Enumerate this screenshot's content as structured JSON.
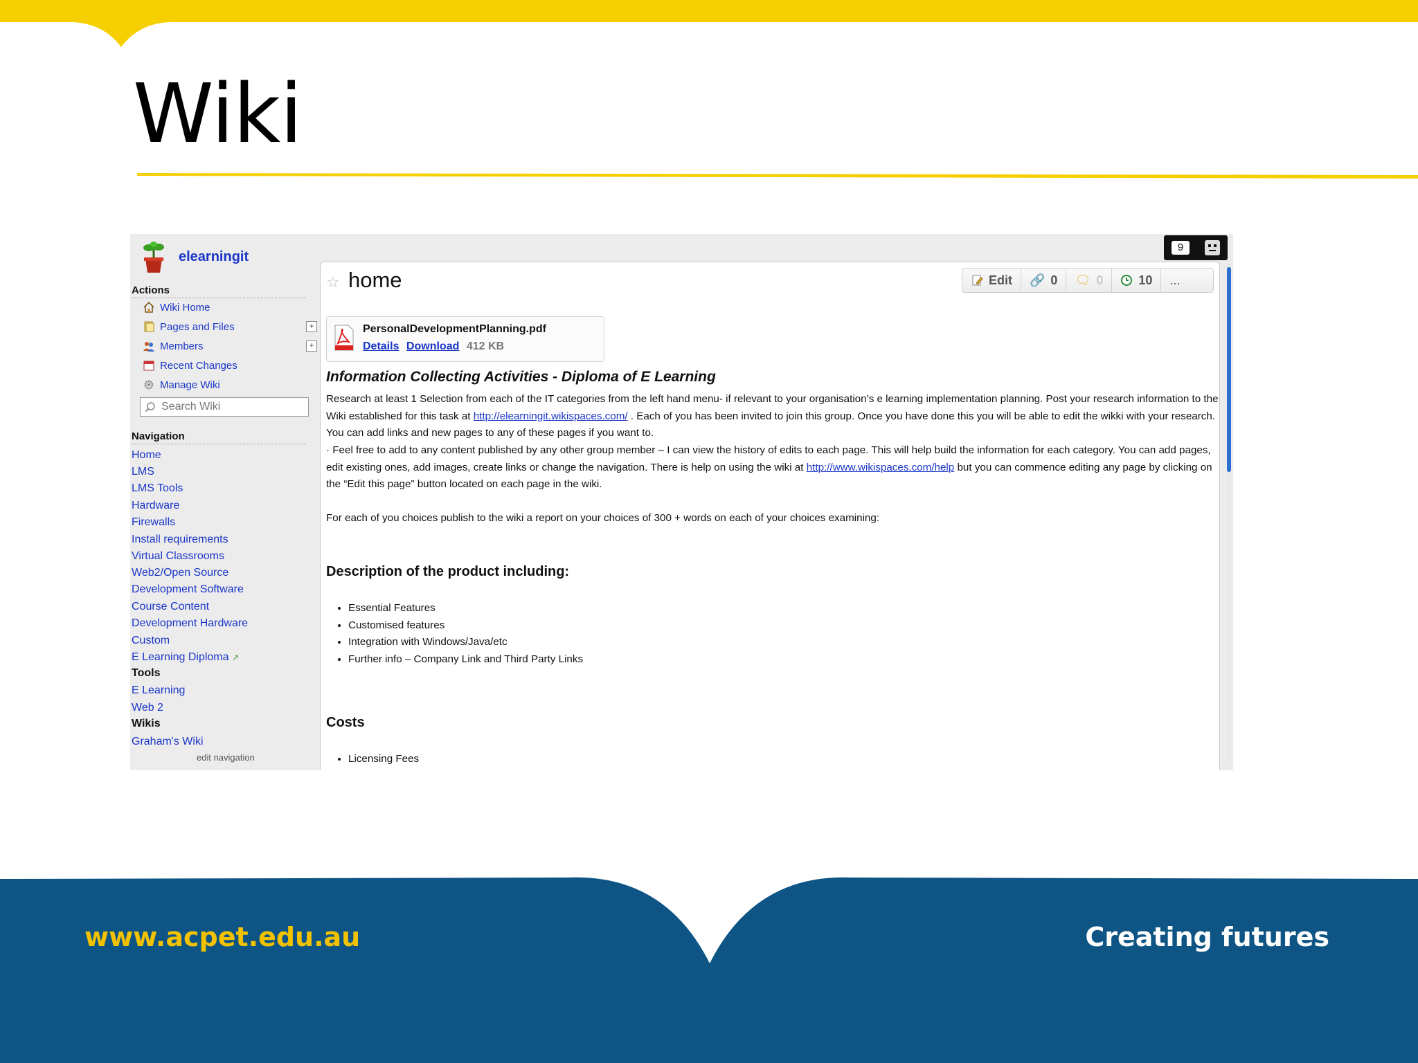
{
  "slide": {
    "title": "Wiki",
    "footer_url": "www.acpet.edu.au",
    "footer_tagline": "Creating futures",
    "colors": {
      "accent_yellow": "#f5cf00",
      "footer_blue": "#0e5585"
    }
  },
  "wiki": {
    "name": "elearningit",
    "topbar": {
      "notification_count": "9"
    },
    "actions": {
      "heading": "Actions",
      "items": [
        {
          "label": "Wiki Home",
          "icon": "home-icon"
        },
        {
          "label": "Pages and Files",
          "icon": "pages-icon"
        },
        {
          "label": "Members",
          "icon": "members-icon"
        },
        {
          "label": "Recent Changes",
          "icon": "calendar-icon"
        },
        {
          "label": "Manage Wiki",
          "icon": "gear-icon"
        }
      ]
    },
    "search": {
      "placeholder": "Search Wiki"
    },
    "navigation": {
      "heading": "Navigation",
      "items": [
        "Home",
        "LMS",
        "LMS Tools",
        "Hardware",
        "Firewalls",
        "Install requirements",
        "Virtual Classrooms",
        "Web2/Open Source",
        "Development Software",
        "Course Content",
        "Development Hardware",
        "Custom",
        "E Learning Diploma"
      ],
      "tools_heading": "Tools",
      "tools_items": [
        "E Learning",
        "Web 2"
      ],
      "wikis_heading": "Wikis",
      "wikis_items": [
        "Graham's Wiki"
      ],
      "edit_link": "edit navigation"
    },
    "page": {
      "title": "home",
      "toolbar": {
        "edit_label": "Edit",
        "links_count": "0",
        "comments_count": "0",
        "history_count": "10",
        "more_label": "..."
      },
      "file": {
        "name": "PersonalDevelopmentPlanning.pdf",
        "details_label": "Details",
        "download_label": "Download",
        "size": "412 KB"
      },
      "heading": "Information Collecting Activities - Diploma of E Learning",
      "para1_a": "Research at least 1 Selection from each of the IT categories from the left hand menu- if relevant to your organisation’s e learning implementation planning. Post your research information to the Wiki established for this task at ",
      "para1_link": "http://elearningit.wikispaces.com/",
      "para1_b": " . Each of you has been invited to join this group. Once you have done this you will be able to edit the wikki with your research. You can add links and new pages to any of these pages if you want to.",
      "para2_a": "· Feel free to add to any content published by any other group member – I can view the history of edits to each page. This will help build the information for each category. You can add pages, edit existing ones, add images, create links or change the navigation. There is help on using the wiki at ",
      "para2_link": "http://www.wikispaces.com/help",
      "para2_b": " but you can commence editing any page by clicking on the “Edit this page” button located on each page in the wiki.",
      "para3": "For each of you choices publish to the wiki a report on your choices of 300 + words on each of your choices examining:",
      "section1_heading": "Description of the product including:",
      "section1_items": [
        "Essential Features",
        "Customised features",
        "Integration with Windows/Java/etc",
        "Further info – Company Link and Third Party Links"
      ],
      "section2_heading": "Costs",
      "section2_items": [
        "Licensing Fees"
      ]
    }
  }
}
